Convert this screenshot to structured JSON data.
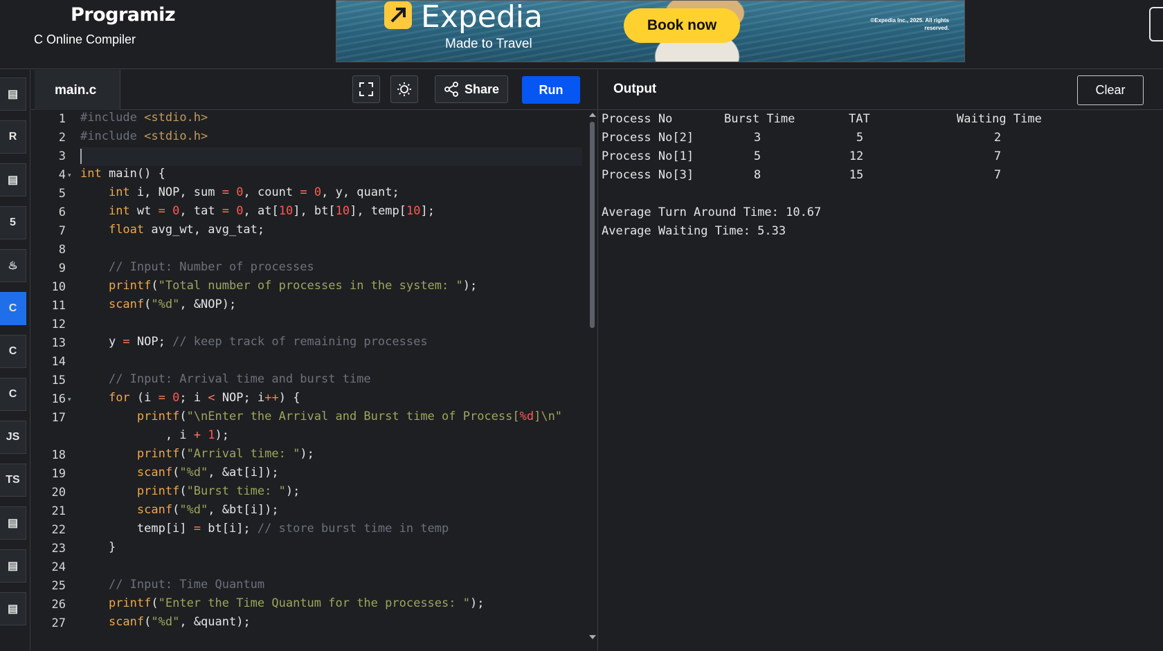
{
  "header": {
    "logo_text": "Programiz",
    "subtitle": "C Online Compiler"
  },
  "ad": {
    "brand": "Expedia",
    "tagline": "Made to Travel",
    "cta": "Book now",
    "legal": "©Expedia Inc., 2025. All rights reserved."
  },
  "sidebar": {
    "languages": [
      {
        "name": "python-icon",
        "glyph": "",
        "active": false
      },
      {
        "name": "r-icon",
        "glyph": "R",
        "active": false
      },
      {
        "name": "sql-icon",
        "glyph": "",
        "active": false
      },
      {
        "name": "html-icon",
        "glyph": "5",
        "active": false
      },
      {
        "name": "java-icon",
        "glyph": "♨",
        "active": false
      },
      {
        "name": "c-icon",
        "glyph": "C",
        "active": true
      },
      {
        "name": "cpp-icon",
        "glyph": "C",
        "active": false
      },
      {
        "name": "csharp-icon",
        "glyph": "C",
        "active": false
      },
      {
        "name": "javascript-icon",
        "glyph": "JS",
        "active": false
      },
      {
        "name": "typescript-icon",
        "glyph": "TS",
        "active": false
      },
      {
        "name": "go-icon",
        "glyph": "",
        "active": false
      },
      {
        "name": "swift-icon",
        "glyph": "",
        "active": false
      },
      {
        "name": "rust-icon",
        "glyph": "",
        "active": false
      }
    ]
  },
  "editor": {
    "file_name": "main.c",
    "share_label": "Share",
    "run_label": "Run",
    "line_numbers": [
      "1",
      "2",
      "3",
      "4",
      "5",
      "6",
      "7",
      "8",
      "9",
      "10",
      "11",
      "12",
      "13",
      "14",
      "15",
      "16",
      "17",
      "",
      "18",
      "19",
      "20",
      "21",
      "22",
      "23",
      "24",
      "25",
      "26",
      "27"
    ]
  },
  "output": {
    "title": "Output",
    "clear_label": "Clear",
    "table_headers": [
      "Process No",
      "Burst Time",
      "TAT",
      "Waiting Time"
    ],
    "rows": [
      [
        "Process No[2]",
        "3",
        "5",
        "2"
      ],
      [
        "Process No[1]",
        "5",
        "12",
        "7"
      ],
      [
        "Process No[3]",
        "8",
        "15",
        "7"
      ]
    ],
    "avg_tat": "Average Turn Around Time: 10.67",
    "avg_wt": "Average Waiting Time: 5.33"
  }
}
